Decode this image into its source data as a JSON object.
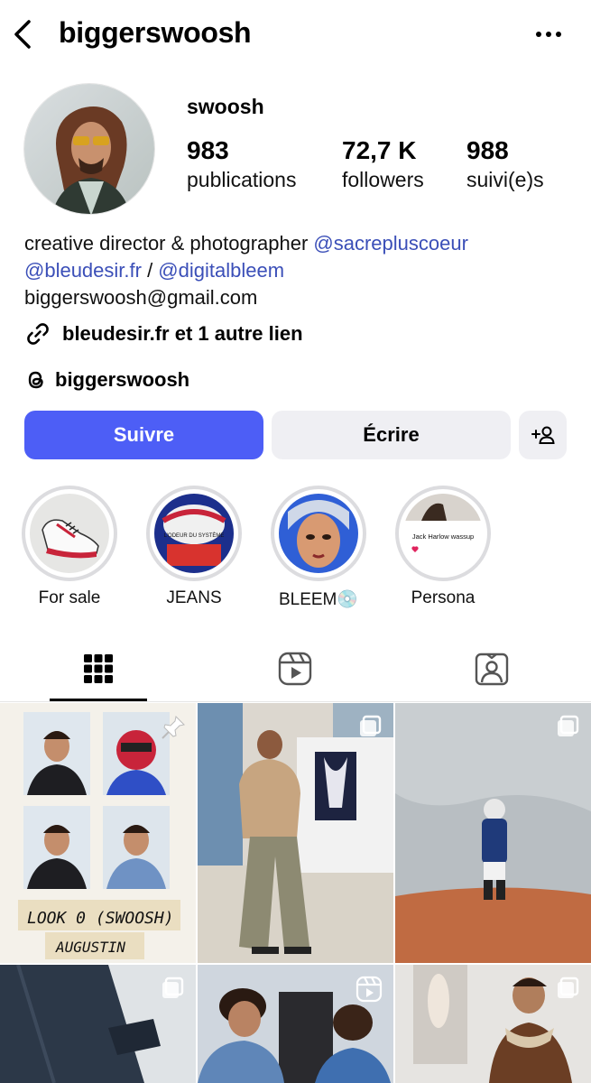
{
  "header": {
    "username": "biggerswoosh",
    "back_icon": "chevron-left-icon",
    "more_icon": "more-horizontal-icon"
  },
  "profile": {
    "display_name": "swoosh",
    "stats": [
      {
        "value": "983",
        "label": "publications"
      },
      {
        "value": "72,7 K",
        "label": "followers"
      },
      {
        "value": "988",
        "label": "suivi(e)s"
      }
    ],
    "bio": {
      "line1_text": "creative director & photographer ",
      "line1_mention": "@sacrepluscoeur",
      "line2_mention_a": "@bleudesir.fr",
      "line2_separator": " / ",
      "line2_mention_b": "@digitalbleem",
      "line3_email": "biggerswoosh@gmail.com"
    },
    "link_text": "bleudesir.fr et 1 autre lien",
    "threads_handle": "biggerswoosh"
  },
  "actions": {
    "follow_label": "Suivre",
    "message_label": "Écrire",
    "suggest_icon": "add-person-icon"
  },
  "highlights": [
    {
      "label": "For sale"
    },
    {
      "label": "JEANS",
      "image_text": "L'ODEUR DU SYSTÈME"
    },
    {
      "label": "BLEEM💿"
    },
    {
      "label": "Persona",
      "image_text": "Jack Harlow wassup"
    }
  ],
  "tabs": [
    {
      "icon": "grid-icon",
      "active": true
    },
    {
      "icon": "reels-icon",
      "active": false
    },
    {
      "icon": "tagged-icon",
      "active": false
    }
  ],
  "grid": {
    "post1_handwriting_a": "LOOK 0 (SWOOSH)",
    "post1_handwriting_b": "AUGUSTIN"
  },
  "colors": {
    "accent": "#4d5ef6",
    "mention": "#3b4fb8",
    "secondary_button": "#efeff3"
  }
}
